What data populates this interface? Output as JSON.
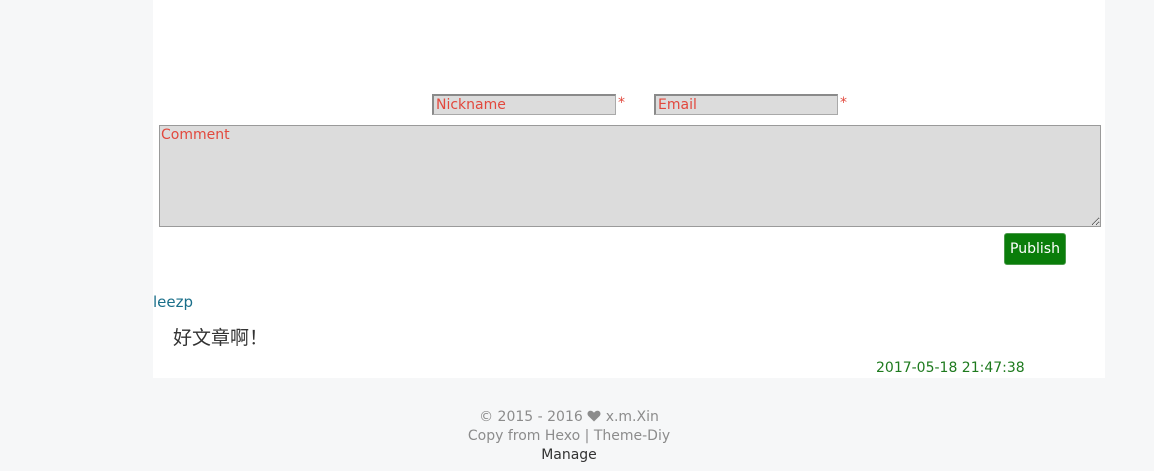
{
  "form": {
    "nickname_placeholder": "Nickname",
    "email_placeholder": "Email",
    "required_mark": "*",
    "comment_placeholder": "Comment",
    "publish_label": "Publish"
  },
  "comments": [
    {
      "author": "leezp",
      "body": "好文章啊！",
      "time": "2017-05-18 21:47:38"
    }
  ],
  "footer": {
    "copyright": "© 2015 - 2016",
    "heart_icon": "heart-icon",
    "owner": "x.m.Xin",
    "copy_from": "Copy from",
    "hexo_link": "Hexo",
    "separator": "|",
    "theme_link": "Theme-Diy",
    "manage_link": "Manage"
  },
  "colors": {
    "accent_red": "#e2483d",
    "publish_green": "#0a7d0a",
    "author_teal": "#1a6f8a",
    "time_green": "#1e7a1e",
    "field_gray": "#dcdcdc"
  }
}
